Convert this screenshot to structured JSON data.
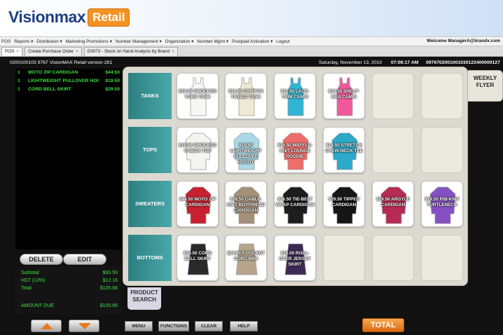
{
  "brand": {
    "name": "Visionmax",
    "suffix": "Retail"
  },
  "menu": [
    "POS",
    "Reports ▾",
    "Distribution ▾",
    "Marketing Promotions ▾",
    "Number Management ▾",
    "Organization ▾",
    "Number Mgmt ▾",
    "Postpaid Activation ▾",
    "Logout"
  ],
  "welcome": "Welcome ManagerA@brandx.com",
  "tabs": [
    {
      "label": "POS",
      "active": true
    },
    {
      "label": "Create Purchase Order",
      "active": false
    },
    {
      "label": "D0073 - Stock on Hand Analysis by Brand",
      "active": false
    }
  ],
  "status": {
    "left": "0200100103  9767  VisionMAX Retail  version 281",
    "date": "Saturday, November 13, 2010",
    "time": "07:06:17 AM",
    "code": "0976702001001030123400000127"
  },
  "receipt": {
    "items": [
      {
        "qty": "1",
        "name": "MOTO ZIP CARDIGAN",
        "price": "$44.50"
      },
      {
        "qty": "1",
        "name": "LIGHTWEIGHT PULLOVER HOO...",
        "price": "$19.50"
      },
      {
        "qty": "1",
        "name": "CORD BELL SKIRT",
        "price": "$29.50"
      }
    ],
    "delete_label": "DELETE",
    "edit_label": "EDIT",
    "subtotal_label": "Subtotal",
    "subtotal": "$93.50",
    "tax_label": "HST (13%)",
    "tax": "$12.16",
    "total_label": "Total",
    "total": "$105.66",
    "amount_due_label": "AMOUNT DUE",
    "amount_due": "$105.66"
  },
  "weekly_flyer": "WEEKLY FLYER",
  "product_search": "PRODUCT SEARCH",
  "categories": [
    {
      "label": "TANKS",
      "products": [
        {
          "label": "$19.50 SMOCKED YOKE TANK",
          "color": "#f7f7f5",
          "kind": "tank"
        },
        {
          "label": "$16.50 CHIFFON TIERED TANK",
          "color": "#efe9d4",
          "kind": "tank"
        },
        {
          "label": "$12.50 LACE-TRIM CAMIS",
          "color": "#30b6d4",
          "kind": "tank"
        },
        {
          "label": "$10.50 SHELF-BRA CAMIS",
          "color": "#f05a9c",
          "kind": "tank"
        }
      ]
    },
    {
      "label": "TOPS",
      "products": [
        {
          "label": "$19.50 SMOCKED V-NECK TOP",
          "color": "#f3f3f1",
          "kind": "top"
        },
        {
          "label": "$19.50 LIGHTWEIGHT PULLOVER HOODY",
          "color": "#a9d8e6",
          "kind": "top"
        },
        {
          "label": "$16.50 WAFFLE-KNIT LOUNGE HOODIE",
          "color": "#ee6d6a",
          "kind": "top"
        },
        {
          "label": "$14.50 STRETCH CREW-NECK TEE",
          "color": "#2ba9c8",
          "kind": "top"
        }
      ]
    },
    {
      "label": "SWEATERS",
      "products": [
        {
          "label": "$44.50 MOTO ZIP CARDIGAN",
          "color": "#c8202f",
          "kind": "top"
        },
        {
          "label": "$39.50 CABLE-KNIT BOYFRIEND CARDIGAN",
          "color": "#a49076",
          "kind": "top"
        },
        {
          "label": "$36.50 TIE-BELT WRAP CARDIGAN",
          "color": "#1d1d1d",
          "kind": "top"
        },
        {
          "label": "$29.50 TIPPED CARDIGAN",
          "color": "#151515",
          "kind": "top"
        },
        {
          "label": "$29.50 ARGYLE CARDIGAN",
          "color": "#b72a54",
          "kind": "top"
        },
        {
          "label": "$19.50 RIB-KNIT TURTLENECK",
          "color": "#8450c2",
          "kind": "top"
        }
      ]
    },
    {
      "label": "BOTTOMS",
      "products": [
        {
          "label": "$29.50 CORD BELL SKIRT",
          "color": "#2a2a2a",
          "kind": "skirt"
        },
        {
          "label": "$24.50 5-POCKET CORD MINI",
          "color": "#b6a58c",
          "kind": "skirt"
        },
        {
          "label": "$15.00 ROLL-OVER JERSEY SKIRT",
          "color": "#3c2a55",
          "kind": "skirt"
        }
      ]
    }
  ],
  "footer": {
    "menu": "MENU",
    "functions": "FUNCTIONS",
    "clear": "CLEAR",
    "help": "HELP",
    "total": "TOTAL"
  }
}
